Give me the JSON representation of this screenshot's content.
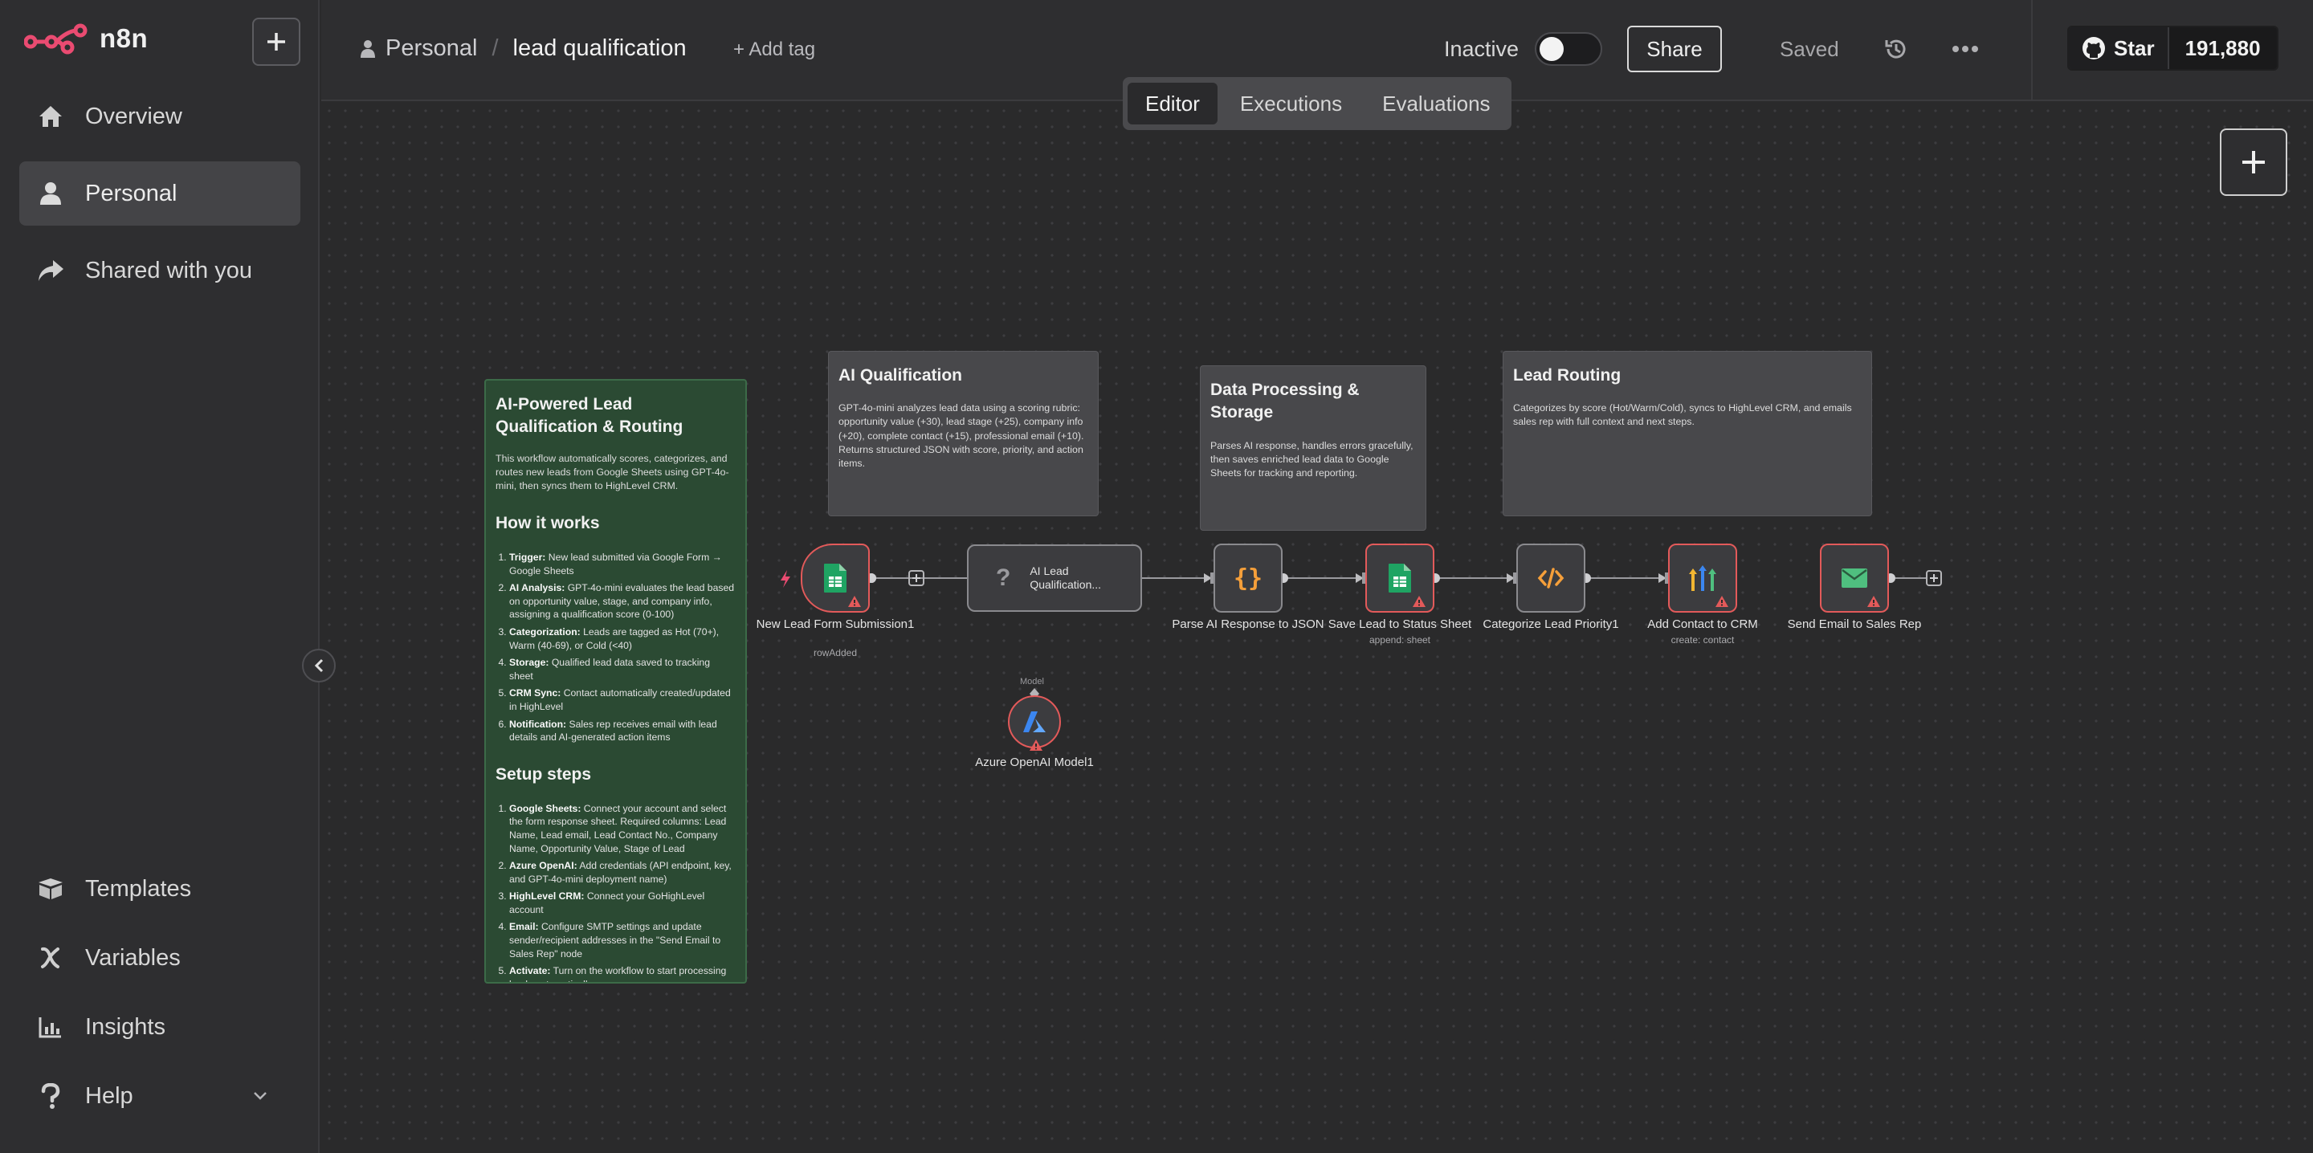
{
  "app": {
    "name": "n8n"
  },
  "sidebar": {
    "items": [
      {
        "label": "Overview",
        "icon": "home-icon"
      },
      {
        "label": "Personal",
        "icon": "user-icon"
      },
      {
        "label": "Shared with you",
        "icon": "share-icon"
      }
    ],
    "bottom_items": [
      {
        "label": "Templates",
        "icon": "box-icon"
      },
      {
        "label": "Variables",
        "icon": "variable-icon"
      },
      {
        "label": "Insights",
        "icon": "chart-icon"
      },
      {
        "label": "Help",
        "icon": "help-icon"
      }
    ]
  },
  "header": {
    "project": "Personal",
    "workflow_name": "lead qualification",
    "add_tag": "+ Add tag",
    "status": "Inactive",
    "share": "Share",
    "saved": "Saved",
    "github_star": "Star",
    "github_count": "191,880"
  },
  "tabs": [
    "Editor",
    "Executions",
    "Evaluations"
  ],
  "colors": {
    "error": "#e35a5a",
    "sheets": "#1fa463",
    "code": "#f59f3a",
    "email": "#4fbf7f",
    "azure": "#3b86f0"
  },
  "stickies": {
    "main": {
      "title": "AI-Powered Lead Qualification & Routing",
      "intro": "This workflow automatically scores, categorizes, and routes new leads from Google Sheets using GPT-4o-mini, then syncs them to HighLevel CRM.",
      "how_title": "How it works",
      "how": [
        {
          "b": "Trigger:",
          "t": " New lead submitted via Google Form → Google Sheets"
        },
        {
          "b": "AI Analysis:",
          "t": " GPT-4o-mini evaluates the lead based on opportunity value, stage, and company info, assigning a qualification score (0-100)"
        },
        {
          "b": "Categorization:",
          "t": " Leads are tagged as Hot (70+), Warm (40-69), or Cold (<40)"
        },
        {
          "b": "Storage:",
          "t": " Qualified lead data saved to tracking sheet"
        },
        {
          "b": "CRM Sync:",
          "t": " Contact automatically created/updated in HighLevel"
        },
        {
          "b": "Notification:",
          "t": " Sales rep receives email with lead details and AI-generated action items"
        }
      ],
      "setup_title": "Setup steps",
      "setup": [
        {
          "b": "Google Sheets:",
          "t": " Connect your account and select the form response sheet. Required columns: Lead Name, Lead email, Lead Contact No., Company Name, Opportunity Value, Stage of Lead"
        },
        {
          "b": "Azure OpenAI:",
          "t": " Add credentials (API endpoint, key, and GPT-4o-mini deployment name)"
        },
        {
          "b": "HighLevel CRM:",
          "t": " Connect your GoHighLevel account"
        },
        {
          "b": "Email:",
          "t": " Configure SMTP settings and update sender/recipient addresses in the \"Send Email to Sales Rep\" node"
        },
        {
          "b": "Activate:",
          "t": " Turn on the workflow to start processing leads automatically"
        }
      ]
    },
    "ai": {
      "title": "AI Qualification",
      "body": "GPT-4o-mini analyzes lead data using a scoring rubric: opportunity value (+30), lead stage (+25), company info (+20), complete contact (+15), professional email (+10). Returns structured JSON with score, priority, and action items."
    },
    "data": {
      "title": "Data Processing & Storage",
      "body": "Parses AI response, handles errors gracefully, then saves enriched lead data to Google Sheets for tracking and reporting."
    },
    "routing": {
      "title": "Lead Routing",
      "body": "Categorizes by score (Hot/Warm/Cold), syncs to HighLevel CRM, and emails sales rep with full context and next steps."
    }
  },
  "nodes": {
    "trigger": {
      "label": "New Lead Form Submission1",
      "sub": "rowAdded"
    },
    "ai_agent": {
      "label": "AI Lead Qualification..."
    },
    "parse": {
      "label": "Parse AI Response to JSON"
    },
    "save": {
      "label": "Save Lead to Status Sheet",
      "sub": "append: sheet"
    },
    "categorize": {
      "label": "Categorize Lead Priority1"
    },
    "crm": {
      "label": "Add Contact to CRM",
      "sub": "create: contact"
    },
    "email": {
      "label": "Send Email to Sales Rep"
    },
    "azure": {
      "label": "Azure OpenAI Model1",
      "port_label": "Model"
    }
  }
}
